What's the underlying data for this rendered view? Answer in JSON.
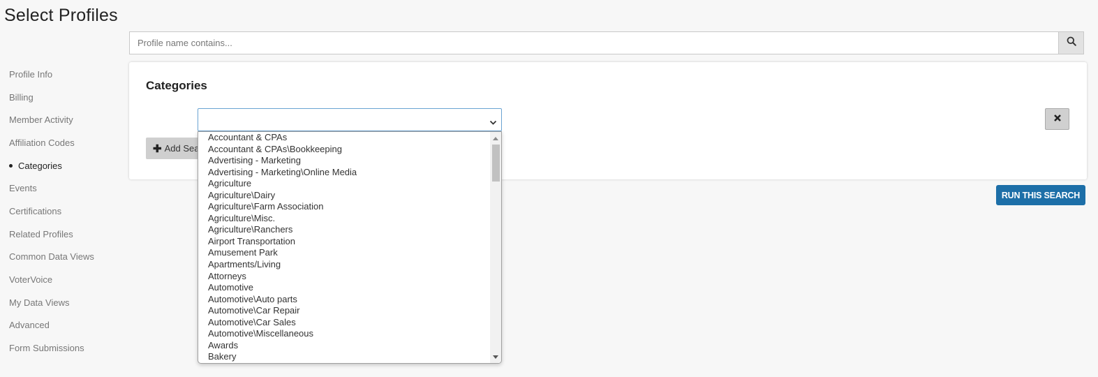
{
  "page": {
    "title": "Select Profiles"
  },
  "search": {
    "placeholder": "Profile name contains...",
    "value": ""
  },
  "sidebar": {
    "items": [
      {
        "label": "Profile Info"
      },
      {
        "label": "Billing"
      },
      {
        "label": "Member Activity"
      },
      {
        "label": "Affiliation Codes"
      },
      {
        "label": "Categories",
        "active": true
      },
      {
        "label": "Events"
      },
      {
        "label": "Certifications"
      },
      {
        "label": "Related Profiles"
      },
      {
        "label": "Common Data Views"
      },
      {
        "label": "VoterVoice"
      },
      {
        "label": "My Data Views"
      },
      {
        "label": "Advanced"
      },
      {
        "label": "Form Submissions"
      }
    ]
  },
  "categories_card": {
    "title": "Categories",
    "select_value": "",
    "add_button_label": "Add Search",
    "remove_icon": "close-icon"
  },
  "run_button_label": "RUN THIS SEARCH",
  "dropdown": {
    "options": [
      "Accountant & CPAs",
      "Accountant & CPAs\\Bookkeeping",
      "Advertising - Marketing",
      "Advertising - Marketing\\Online Media",
      "Agriculture",
      "Agriculture\\Dairy",
      "Agriculture\\Farm Association",
      "Agriculture\\Misc.",
      "Agriculture\\Ranchers",
      "Airport Transportation",
      "Amusement Park",
      "Apartments/Living",
      "Attorneys",
      "Automotive",
      "Automotive\\Auto parts",
      "Automotive\\Car Repair",
      "Automotive\\Car Sales",
      "Automotive\\Miscellaneous",
      "Awards",
      "Bakery"
    ]
  },
  "colors": {
    "accent": "#1d6fa8",
    "select_border": "#6aa3d2",
    "page_bg": "#f7f7f7"
  }
}
